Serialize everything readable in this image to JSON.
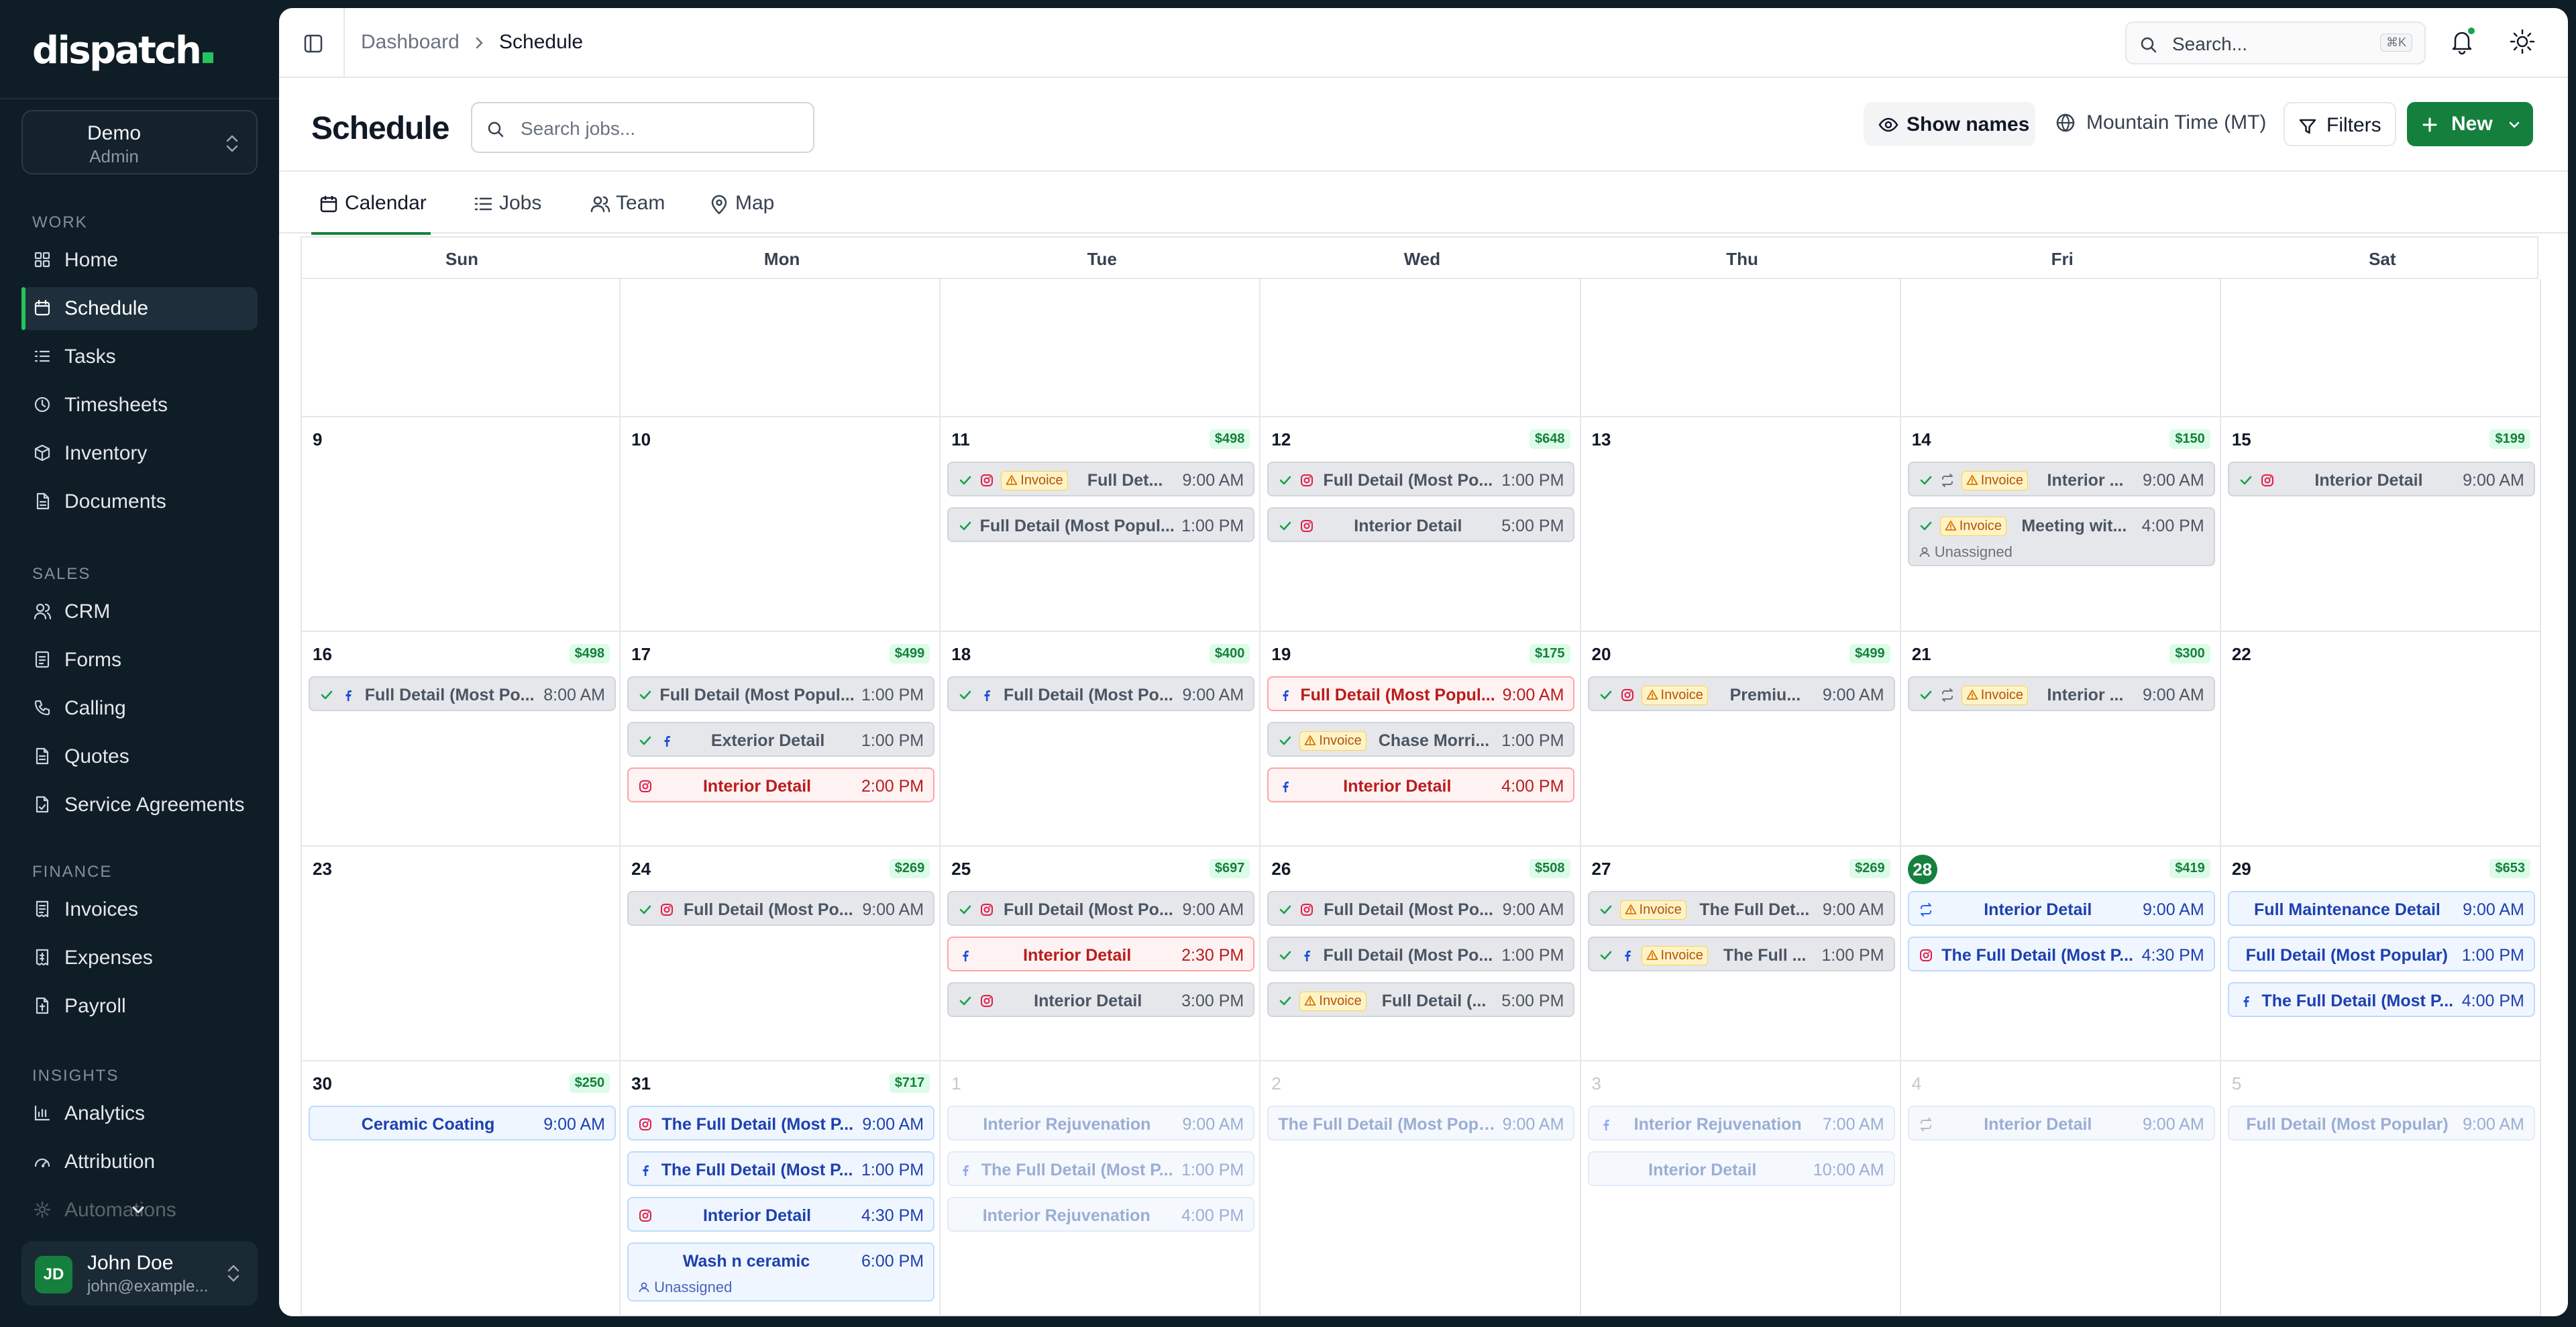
{
  "brand": {
    "logo_text": "dispatch",
    "accent": "#22c55e",
    "primary": "#15803d"
  },
  "org": {
    "name": "Demo",
    "role": "Admin"
  },
  "sidebar": {
    "sections": [
      {
        "label": "WORK",
        "items": [
          {
            "label": "Home",
            "icon": "home-icon"
          },
          {
            "label": "Schedule",
            "icon": "calendar-icon",
            "active": true
          },
          {
            "label": "Tasks",
            "icon": "list-icon"
          },
          {
            "label": "Timesheets",
            "icon": "clock-icon"
          },
          {
            "label": "Inventory",
            "icon": "box-icon"
          },
          {
            "label": "Documents",
            "icon": "document-icon"
          }
        ]
      },
      {
        "label": "SALES",
        "items": [
          {
            "label": "CRM",
            "icon": "users-icon"
          },
          {
            "label": "Forms",
            "icon": "form-icon"
          },
          {
            "label": "Calling",
            "icon": "phone-icon"
          },
          {
            "label": "Quotes",
            "icon": "quote-icon"
          },
          {
            "label": "Service Agreements",
            "icon": "agreement-icon"
          }
        ]
      },
      {
        "label": "FINANCE",
        "items": [
          {
            "label": "Invoices",
            "icon": "invoice-icon"
          },
          {
            "label": "Expenses",
            "icon": "expense-icon"
          },
          {
            "label": "Payroll",
            "icon": "payroll-icon"
          }
        ]
      },
      {
        "label": "INSIGHTS",
        "items": [
          {
            "label": "Analytics",
            "icon": "chart-icon"
          },
          {
            "label": "Attribution",
            "icon": "attribution-icon"
          },
          {
            "label": "Automations",
            "icon": "automation-icon"
          }
        ]
      }
    ]
  },
  "user": {
    "initials": "JD",
    "name": "John Doe",
    "email": "john@example..."
  },
  "topbar": {
    "crumb_parent": "Dashboard",
    "crumb_current": "Schedule",
    "search_placeholder": "Search...",
    "search_shortcut": "⌘K"
  },
  "header": {
    "title": "Schedule",
    "search_placeholder": "Search jobs...",
    "show_names": "Show names",
    "timezone": "Mountain Time (MT)",
    "filters": "Filters",
    "new": "New"
  },
  "tabs": [
    "Calendar",
    "Jobs",
    "Team",
    "Map"
  ],
  "calendar": {
    "weekdays": [
      "Sun",
      "Mon",
      "Tue",
      "Wed",
      "Thu",
      "Fri",
      "Sat"
    ],
    "weeks": [
      {
        "days": [
          {
            "num": ""
          },
          {
            "num": ""
          },
          {
            "num": ""
          },
          {
            "num": ""
          },
          {
            "num": ""
          },
          {
            "num": ""
          },
          {
            "num": ""
          }
        ]
      },
      {
        "days": [
          {
            "num": "9"
          },
          {
            "num": "10"
          },
          {
            "num": "11",
            "total": "$498",
            "events": [
              {
                "style": "done",
                "icons": [
                  "check",
                  "instagram"
                ],
                "invoice": "Invoice",
                "title": "Full Det...",
                "time": "9:00 AM"
              },
              {
                "style": "done",
                "icons": [
                  "check"
                ],
                "title": "Full Detail (Most Popul...",
                "time": "1:00 PM"
              }
            ]
          },
          {
            "num": "12",
            "total": "$648",
            "events": [
              {
                "style": "done",
                "icons": [
                  "check",
                  "instagram"
                ],
                "title": "Full Detail (Most Po...",
                "time": "1:00 PM"
              },
              {
                "style": "done",
                "icons": [
                  "check",
                  "instagram"
                ],
                "title": "Interior Detail",
                "time": "5:00 PM"
              }
            ]
          },
          {
            "num": "13"
          },
          {
            "num": "14",
            "total": "$150",
            "events": [
              {
                "style": "done",
                "icons": [
                  "check",
                  "repeat"
                ],
                "invoice": "Invoice",
                "title": "Interior ...",
                "time": "9:00 AM"
              },
              {
                "style": "done",
                "tall": true,
                "icons": [
                  "check"
                ],
                "invoice": "Invoice",
                "title": "Meeting wit...",
                "time": "4:00 PM",
                "sub": "Unassigned"
              }
            ]
          },
          {
            "num": "15",
            "total": "$199",
            "events": [
              {
                "style": "done",
                "icons": [
                  "check",
                  "instagram"
                ],
                "title": "Interior Detail",
                "time": "9:00 AM"
              }
            ]
          }
        ]
      },
      {
        "days": [
          {
            "num": "16",
            "total": "$498",
            "events": [
              {
                "style": "done",
                "icons": [
                  "check",
                  "facebook"
                ],
                "title": "Full Detail (Most Po...",
                "time": "8:00 AM"
              }
            ]
          },
          {
            "num": "17",
            "total": "$499",
            "events": [
              {
                "style": "done",
                "icons": [
                  "check"
                ],
                "title": "Full Detail (Most Popul...",
                "time": "1:00 PM"
              },
              {
                "style": "done",
                "icons": [
                  "check",
                  "facebook"
                ],
                "title": "Exterior Detail",
                "time": "1:00 PM"
              },
              {
                "style": "red",
                "icons": [
                  "instagram"
                ],
                "title": "Interior Detail",
                "time": "2:00 PM"
              }
            ]
          },
          {
            "num": "18",
            "total": "$400",
            "events": [
              {
                "style": "done",
                "icons": [
                  "check",
                  "facebook"
                ],
                "title": "Full Detail (Most Po...",
                "time": "9:00 AM"
              }
            ]
          },
          {
            "num": "19",
            "total": "$175",
            "events": [
              {
                "style": "red",
                "icons": [
                  "facebook"
                ],
                "title": "Full Detail (Most Popul...",
                "time": "9:00 AM"
              },
              {
                "style": "done",
                "icons": [
                  "check"
                ],
                "invoice": "Invoice",
                "title": "Chase Morri...",
                "time": "1:00 PM"
              },
              {
                "style": "red",
                "icons": [
                  "facebook"
                ],
                "title": "Interior Detail",
                "time": "4:00 PM"
              }
            ]
          },
          {
            "num": "20",
            "total": "$499",
            "events": [
              {
                "style": "done",
                "icons": [
                  "check",
                  "instagram"
                ],
                "invoice": "Invoice",
                "title": "Premiu...",
                "time": "9:00 AM"
              }
            ]
          },
          {
            "num": "21",
            "total": "$300",
            "events": [
              {
                "style": "done",
                "icons": [
                  "check",
                  "repeat"
                ],
                "invoice": "Invoice",
                "title": "Interior ...",
                "time": "9:00 AM"
              }
            ]
          },
          {
            "num": "22"
          }
        ]
      },
      {
        "days": [
          {
            "num": "23"
          },
          {
            "num": "24",
            "total": "$269",
            "events": [
              {
                "style": "done",
                "icons": [
                  "check",
                  "instagram"
                ],
                "title": "Full Detail (Most Po...",
                "time": "9:00 AM"
              }
            ]
          },
          {
            "num": "25",
            "total": "$697",
            "events": [
              {
                "style": "done",
                "icons": [
                  "check",
                  "instagram"
                ],
                "title": "Full Detail (Most Po...",
                "time": "9:00 AM"
              },
              {
                "style": "red",
                "icons": [
                  "facebook"
                ],
                "title": "Interior Detail",
                "time": "2:30 PM"
              },
              {
                "style": "done",
                "icons": [
                  "check",
                  "instagram"
                ],
                "title": "Interior Detail",
                "time": "3:00 PM"
              }
            ]
          },
          {
            "num": "26",
            "total": "$508",
            "events": [
              {
                "style": "done",
                "icons": [
                  "check",
                  "instagram"
                ],
                "title": "Full Detail (Most Po...",
                "time": "9:00 AM"
              },
              {
                "style": "done",
                "icons": [
                  "check",
                  "facebook"
                ],
                "title": "Full Detail (Most Po...",
                "time": "1:00 PM"
              },
              {
                "style": "done",
                "icons": [
                  "check"
                ],
                "invoice": "Invoice",
                "title": "Full Detail (...",
                "time": "5:00 PM"
              }
            ]
          },
          {
            "num": "27",
            "total": "$269",
            "events": [
              {
                "style": "done",
                "icons": [
                  "check"
                ],
                "invoice": "Invoice",
                "title": "The Full Det...",
                "time": "9:00 AM"
              },
              {
                "style": "done",
                "icons": [
                  "check",
                  "facebook"
                ],
                "invoice": "Invoice",
                "title": "The Full ...",
                "time": "1:00 PM"
              }
            ]
          },
          {
            "num": "28",
            "today": true,
            "total": "$419",
            "events": [
              {
                "style": "blue",
                "icons": [
                  "repeat"
                ],
                "title": "Interior Detail",
                "time": "9:00 AM"
              },
              {
                "style": "blue",
                "icons": [
                  "instagram"
                ],
                "title": "The Full Detail (Most P...",
                "time": "4:30 PM"
              }
            ]
          },
          {
            "num": "29",
            "total": "$653",
            "events": [
              {
                "style": "blue",
                "icons": [],
                "title": "Full Maintenance Detail",
                "time": "9:00 AM"
              },
              {
                "style": "blue",
                "icons": [],
                "title": "Full Detail (Most Popular)",
                "time": "1:00 PM"
              },
              {
                "style": "blue",
                "icons": [
                  "facebook"
                ],
                "title": "The Full Detail (Most P...",
                "time": "4:00 PM"
              }
            ]
          }
        ]
      },
      {
        "days": [
          {
            "num": "30",
            "total": "$250",
            "events": [
              {
                "style": "blue",
                "icons": [],
                "title": "Ceramic Coating",
                "time": "9:00 AM"
              }
            ]
          },
          {
            "num": "31",
            "total": "$717",
            "events": [
              {
                "style": "blue",
                "icons": [
                  "instagram"
                ],
                "title": "The Full Detail (Most P...",
                "time": "9:00 AM"
              },
              {
                "style": "blue",
                "icons": [
                  "facebook"
                ],
                "title": "The Full Detail (Most P...",
                "time": "1:00 PM"
              },
              {
                "style": "blue",
                "icons": [
                  "instagram"
                ],
                "title": "Interior Detail",
                "time": "4:30 PM"
              },
              {
                "style": "blue",
                "tall": true,
                "icons": [],
                "title": "Wash n ceramic",
                "time": "6:00 PM",
                "sub": "Unassigned"
              }
            ]
          },
          {
            "num": "1",
            "faded": true,
            "events": [
              {
                "style": "faded",
                "icons": [],
                "title": "Interior Rejuvenation",
                "time": "9:00 AM"
              },
              {
                "style": "faded",
                "icons": [
                  "facebook"
                ],
                "title": "The Full Detail (Most P...",
                "time": "1:00 PM"
              },
              {
                "style": "faded",
                "icons": [],
                "title": "Interior Rejuvenation",
                "time": "4:00 PM"
              }
            ]
          },
          {
            "num": "2",
            "faded": true,
            "events": [
              {
                "style": "faded",
                "icons": [],
                "title": "The Full Detail (Most Popu...",
                "time": "9:00 AM"
              }
            ]
          },
          {
            "num": "3",
            "faded": true,
            "events": [
              {
                "style": "faded",
                "icons": [
                  "facebook"
                ],
                "title": "Interior Rejuvenation",
                "time": "7:00 AM"
              },
              {
                "style": "faded",
                "icons": [],
                "title": "Interior Detail",
                "time": "10:00 AM"
              }
            ]
          },
          {
            "num": "4",
            "faded": true,
            "events": [
              {
                "style": "faded",
                "icons": [
                  "repeat"
                ],
                "title": "Interior Detail",
                "time": "9:00 AM"
              }
            ]
          },
          {
            "num": "5",
            "faded": true,
            "events": [
              {
                "style": "faded",
                "icons": [],
                "title": "Full Detail (Most Popular)",
                "time": "9:00 AM"
              }
            ]
          }
        ]
      }
    ]
  }
}
